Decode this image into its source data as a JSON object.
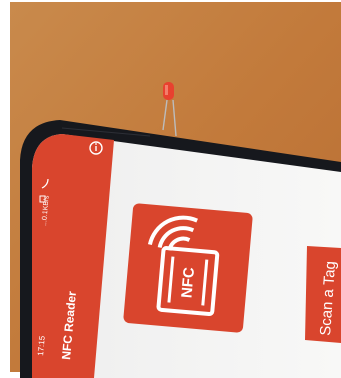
{
  "app": {
    "title": "NFC Reader",
    "logo_text": "NFC",
    "scan_button_label": "Scan a Tag",
    "accent_color": "#d9452d"
  },
  "status_bar": {
    "time": "17:15",
    "network_speed": "...0.1KB/s"
  },
  "icons": {
    "info": "info-icon",
    "wifi": "wifi-icon",
    "nfc_logo": "nfc-phone-icon"
  },
  "colors": {
    "table": "#c98745",
    "phone_body": "#16181d",
    "screen": "#f6f5f3",
    "led": "#e8412f"
  }
}
